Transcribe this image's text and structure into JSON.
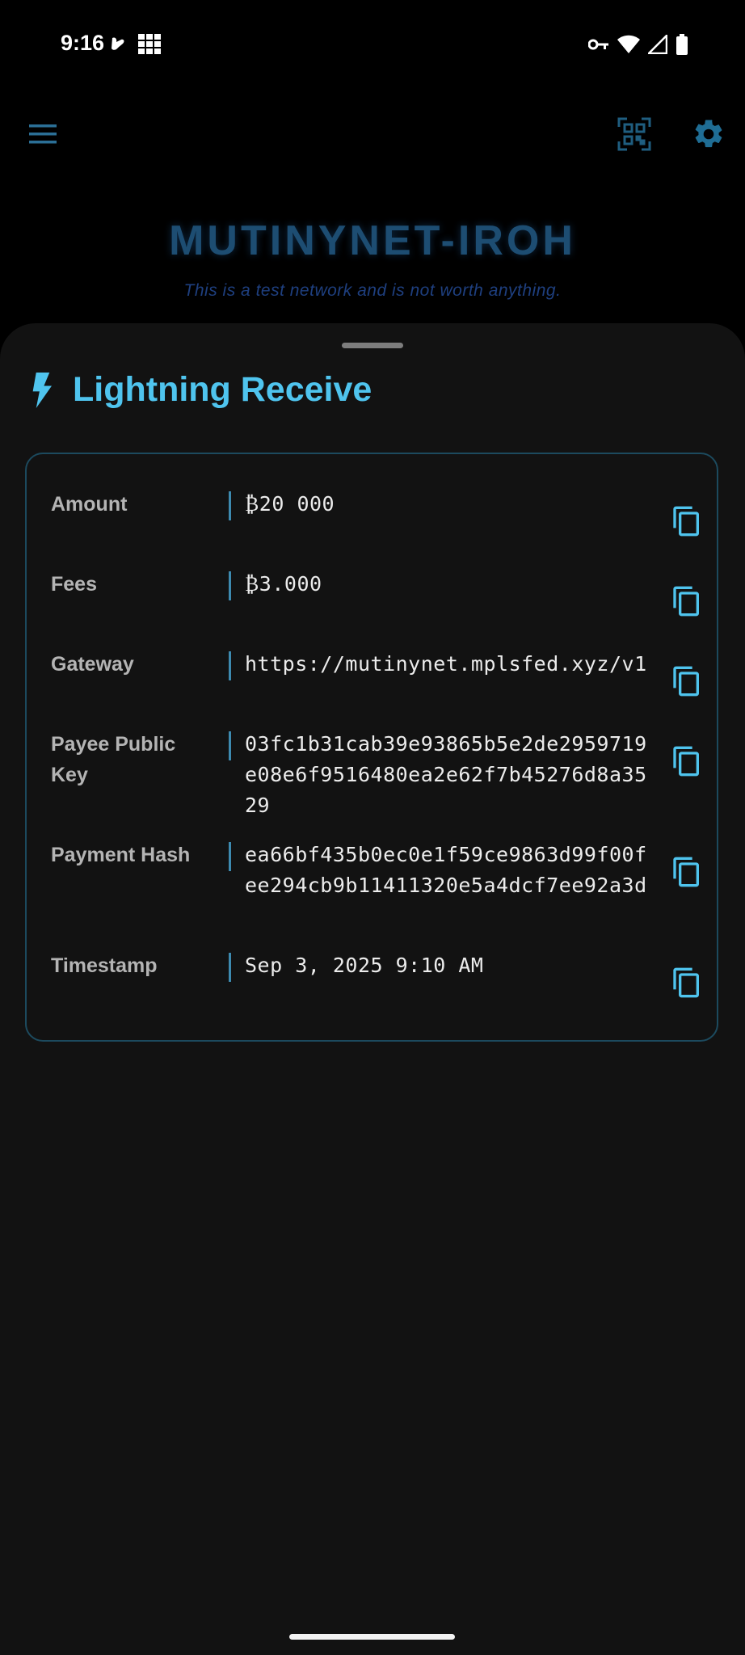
{
  "status_bar": {
    "time": "9:16",
    "left_icons": [
      "notification-icon",
      "grid-app-icon"
    ],
    "right_icons": [
      "vpn-key-icon",
      "wifi-icon",
      "cell-signal-icon",
      "battery-icon"
    ]
  },
  "app_bar": {
    "menu_icon": "menu-icon",
    "qr_icon": "qr-scan-icon",
    "settings_icon": "gear-icon"
  },
  "network": {
    "title": "MUTINYNET-IROH",
    "subtitle": "This is a test network and is not worth anything."
  },
  "sheet": {
    "icon": "lightning-bolt-icon",
    "title": "Lightning Receive",
    "rows": [
      {
        "label": "Amount",
        "value": "₿20 000"
      },
      {
        "label": "Fees",
        "value": "₿3.000"
      },
      {
        "label": "Gateway",
        "value": "https://mutinynet.mplsfed.xyz/v1"
      },
      {
        "label": "Payee Public Key",
        "value": "03fc1b31cab39e93865b5e2de2959719e08e6f9516480ea2e62f7b45276d8a3529"
      },
      {
        "label": "Payment Hash",
        "value": "ea66bf435b0ec0e1f59ce9863d99f00fee294cb9b11411320e5a4dcf7ee92a3d"
      },
      {
        "label": "Timestamp",
        "value": "Sep 3, 2025 9:10 AM"
      }
    ]
  },
  "colors": {
    "accent": "#4fc4ee",
    "title_glow": "#1d4d72",
    "subtitle": "#1e3f7f",
    "sheet_bg": "#121212",
    "card_border": "#1c4a5e"
  }
}
